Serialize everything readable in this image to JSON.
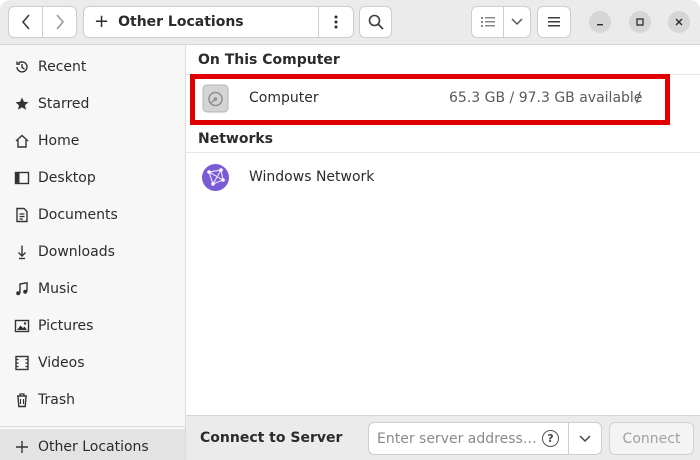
{
  "header": {
    "location": "Other Locations"
  },
  "sidebar": {
    "items": [
      {
        "label": "Recent",
        "icon": "clock-icon"
      },
      {
        "label": "Starred",
        "icon": "star-icon"
      },
      {
        "label": "Home",
        "icon": "home-icon"
      },
      {
        "label": "Desktop",
        "icon": "desktop-icon"
      },
      {
        "label": "Documents",
        "icon": "document-icon"
      },
      {
        "label": "Downloads",
        "icon": "download-icon"
      },
      {
        "label": "Music",
        "icon": "music-icon"
      },
      {
        "label": "Pictures",
        "icon": "picture-icon"
      },
      {
        "label": "Videos",
        "icon": "video-icon"
      },
      {
        "label": "Trash",
        "icon": "trash-icon"
      }
    ],
    "other_locations": {
      "label": "Other Locations",
      "icon": "plus-icon"
    }
  },
  "main": {
    "on_this_computer": {
      "title": "On This Computer",
      "items": [
        {
          "name": "Computer",
          "space": "65.3 GB / 97.3 GB available",
          "mount": "/",
          "icon": "drive-icon"
        }
      ]
    },
    "networks": {
      "title": "Networks",
      "items": [
        {
          "name": "Windows Network",
          "icon": "network-icon"
        }
      ]
    }
  },
  "bottom": {
    "label": "Connect to Server",
    "placeholder": "Enter server address…",
    "connect_label": "Connect"
  },
  "colors": {
    "highlight": "#e00000",
    "network_icon": "#7a5bd6"
  }
}
